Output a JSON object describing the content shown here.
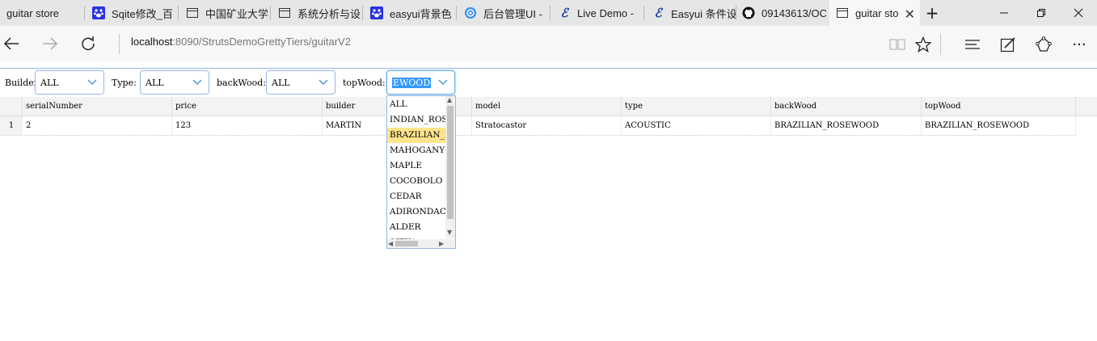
{
  "browser": {
    "tabs": [
      {
        "label": "guitar store"
      },
      {
        "label": "Sqite修改_百"
      },
      {
        "label": "中国矿业大学"
      },
      {
        "label": "系统分析与设"
      },
      {
        "label": "easyui背景色"
      },
      {
        "label": "后台管理UI -"
      },
      {
        "label": "Live Demo -"
      },
      {
        "label": "Easyui 条件设"
      },
      {
        "label": "09143613/OC"
      },
      {
        "label": "guitar sto"
      }
    ],
    "address": {
      "host": "localhost",
      "path": ":8090/StrutsDemoGrettyTiers/guitarV2"
    }
  },
  "filters": {
    "builder": {
      "label": "Builder:",
      "value": "ALL"
    },
    "type": {
      "label": "Type:",
      "value": "ALL"
    },
    "backWood": {
      "label": "backWood:",
      "value": "ALL"
    },
    "topWood": {
      "label": "topWood:",
      "value": "EWOOD"
    }
  },
  "grid": {
    "columns": [
      "serialNumber",
      "price",
      "builder",
      "model",
      "type",
      "backWood",
      "topWood"
    ],
    "rows": [
      {
        "num": "1",
        "serialNumber": "2",
        "price": "123",
        "builder": "MARTIN",
        "model": "Stratocastor",
        "type": "ACOUSTIC",
        "backWood": "BRAZILIAN_ROSEWOOD",
        "topWood": "BRAZILIAN_ROSEWOOD"
      }
    ]
  },
  "dropdown": {
    "options": [
      "ALL",
      "INDIAN_ROSE",
      "BRAZILIAN_R",
      "MAHOGANY",
      "MAPLE",
      "COCOBOLO",
      "CEDAR",
      "ADIRONDACK",
      "ALDER",
      "SITKA"
    ],
    "highlighted_index": 2
  }
}
